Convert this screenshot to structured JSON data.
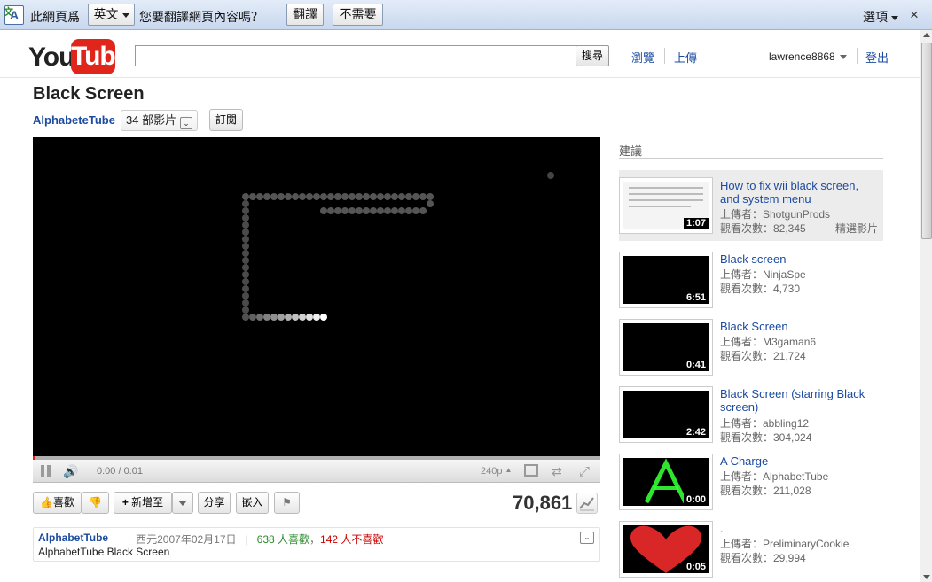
{
  "translate_bar": {
    "prefix": "此網頁爲",
    "language": "英文",
    "question": "您要翻譯網頁內容嗎？",
    "translate_btn": "翻譯",
    "no_btn": "不需要",
    "options": "選項",
    "close": "×"
  },
  "header": {
    "logo_you": "You",
    "logo_tube": "Tube",
    "search_value": "",
    "search_btn": "搜尋",
    "browse": "瀏覽",
    "upload": "上傳",
    "username": "lawrence8868",
    "logout": "登出"
  },
  "video": {
    "title": "Black Screen",
    "channel": "AlphabeteTube",
    "video_count": "34 部影片",
    "subscribe": "訂閱",
    "progress": 0.005,
    "time": "0:00 / 0:01",
    "quality": "240p",
    "like": "喜歡",
    "add_to": "新增至",
    "share": "分享",
    "embed": "嵌入",
    "views": "70,861"
  },
  "info": {
    "channel": "AlphabetTube",
    "date": "西元2007年02月17日",
    "likes": "638 人喜歡",
    "sep": "，",
    "dislikes": "142 人不喜歡",
    "description": "AlphabetTube Black Screen"
  },
  "suggestions": {
    "heading": "建議",
    "items": [
      {
        "title": "How to fix wii black screen, and system menu",
        "uploader": "上傳者：ShotgunProds",
        "views": "觀看次數：82,345",
        "duration": "1:07",
        "featured": "精選影片"
      },
      {
        "title": "Black screen",
        "uploader": "上傳者：NinjaSpe",
        "views": "觀看次數：4,730",
        "duration": "6:51"
      },
      {
        "title": "Black Screen",
        "uploader": "上傳者：M3gaman6",
        "views": "觀看次數：21,724",
        "duration": "0:41"
      },
      {
        "title": "Black Screen (starring Black screen)",
        "uploader": "上傳者：abbling12",
        "views": "觀看次數：304,024",
        "duration": "2:42"
      },
      {
        "title": "A Charge",
        "uploader": "上傳者：AlphabetTube",
        "views": "觀看次數：211,028",
        "duration": "0:00"
      },
      {
        "title": ".",
        "uploader": "上傳者：PreliminaryCookie",
        "views": "觀看次數：29,994",
        "duration": "0:05"
      }
    ]
  },
  "colors": {
    "link": "#1c4ba0",
    "brand_red": "#e0261b"
  }
}
